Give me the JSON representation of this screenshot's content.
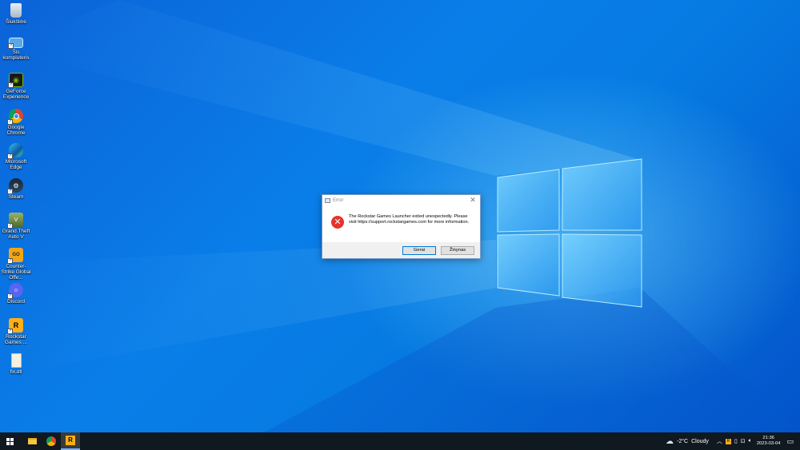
{
  "desktop_icons": [
    {
      "label": "Šiukšlinė",
      "icon": "recycle-bin-icon"
    },
    {
      "label": "Šis kompiuteris",
      "icon": "this-pc-icon"
    },
    {
      "label": "GeForce Experience",
      "icon": "geforce-icon"
    },
    {
      "label": "Google Chrome",
      "icon": "chrome-icon"
    },
    {
      "label": "Microsoft Edge",
      "icon": "edge-icon"
    },
    {
      "label": "Steam",
      "icon": "steam-icon"
    },
    {
      "label": "Grand Theft Auto V",
      "icon": "gta-icon"
    },
    {
      "label": "Counter-Strike Global Offe...",
      "icon": "csgo-icon"
    },
    {
      "label": "Discord",
      "icon": "discord-icon"
    },
    {
      "label": "Rockstar Games ...",
      "icon": "rockstar-icon"
    },
    {
      "label": "fix.dll",
      "icon": "file-icon"
    }
  ],
  "dialog": {
    "title": "Error",
    "close": "✕",
    "message": "The Rockstar Games Launcher exited unexpectedly. Please visit https://support.rockstargames.com for more information.",
    "ok_label": "Gerai",
    "help_label": "Žinynas"
  },
  "taskbar": {
    "weather_temp": "-2°C",
    "weather_text": "Cloudy",
    "time": "21:36",
    "date": "2023-03-04"
  },
  "colors": {
    "accent": "#0078d7",
    "error": "#e8322c"
  }
}
